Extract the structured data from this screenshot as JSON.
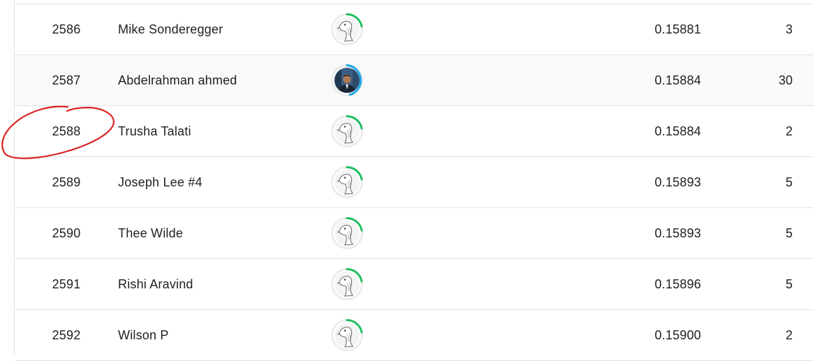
{
  "colors": {
    "ring_green": "#20BE60",
    "ring_blue": "#1EA7E8",
    "annotation_red": "#D92222",
    "row_highlight": "#F8F9FA",
    "divider": "#E3E3E3"
  },
  "leaderboard": {
    "rows": [
      {
        "rank": "2586",
        "name": "Mike Sonderegger",
        "avatar": "goose-avatar-icon",
        "ring": "green",
        "score": "0.15881",
        "entries": "3"
      },
      {
        "rank": "2587",
        "name": "Abdelrahman ahmed",
        "avatar": "user-photo-avatar",
        "ring": "blue",
        "score": "0.15884",
        "entries": "30",
        "highlighted": true
      },
      {
        "rank": "2588",
        "name": "Trusha Talati",
        "avatar": "goose-avatar-icon",
        "ring": "green",
        "score": "0.15884",
        "entries": "2",
        "circled": true
      },
      {
        "rank": "2589",
        "name": "Joseph Lee #4",
        "avatar": "goose-avatar-icon",
        "ring": "green",
        "score": "0.15893",
        "entries": "5"
      },
      {
        "rank": "2590",
        "name": "Thee Wilde",
        "avatar": "goose-avatar-icon",
        "ring": "green",
        "score": "0.15893",
        "entries": "5"
      },
      {
        "rank": "2591",
        "name": "Rishi Aravind",
        "avatar": "goose-avatar-icon",
        "ring": "green",
        "score": "0.15896",
        "entries": "5"
      },
      {
        "rank": "2592",
        "name": "Wilson P",
        "avatar": "goose-avatar-icon",
        "ring": "green",
        "score": "0.15900",
        "entries": "2"
      }
    ]
  }
}
